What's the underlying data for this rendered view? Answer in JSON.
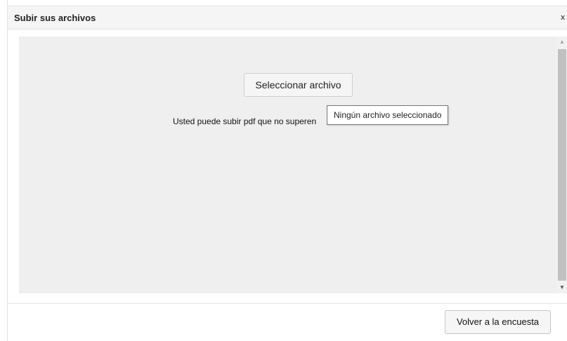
{
  "dialog": {
    "title": "Subir sus archivos",
    "close_label": "x"
  },
  "upload": {
    "choose_file_label": "Seleccionar archivo",
    "note_text": "Usted puede subir pdf que no superen",
    "tooltip_text": "Ningún archivo seleccionado"
  },
  "scrollbar": {
    "up_icon": "scroll-up-arrow-icon",
    "down_icon": "scroll-down-arrow-icon"
  },
  "footer": {
    "back_label": "Volver a la encuesta"
  },
  "colors": {
    "content_background": "#efefef",
    "title_bar_background": "#f5f5f5"
  }
}
